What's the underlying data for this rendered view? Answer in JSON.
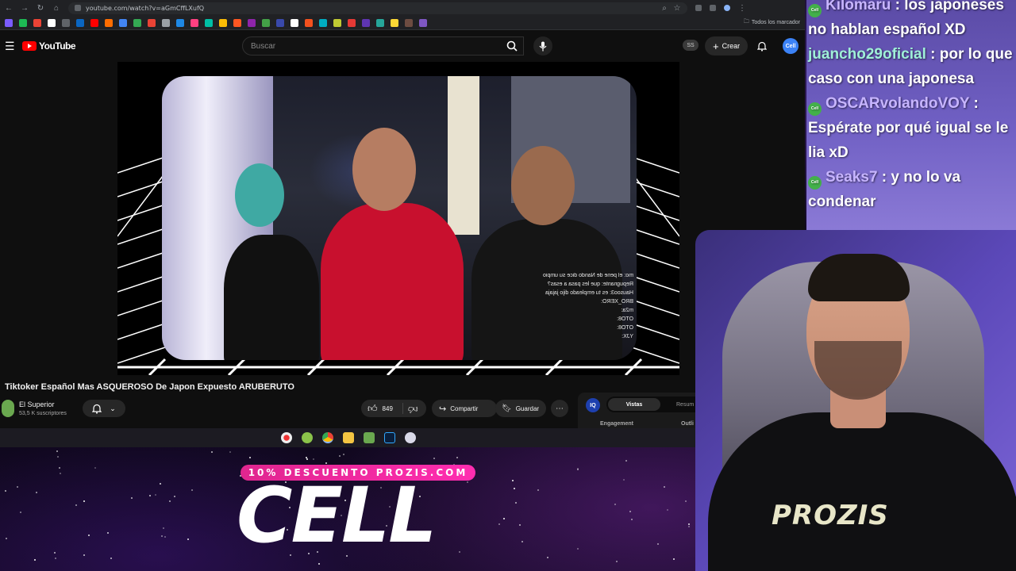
{
  "browser": {
    "url": "youtube.com/watch?v=aGmCffLXufQ",
    "bookmarks_folder": "Todos los marcador"
  },
  "youtube": {
    "brand": "YouTube",
    "search_placeholder": "Buscar",
    "ss_badge": "SS",
    "create_label": "Crear",
    "avatar_label": "Cell"
  },
  "video": {
    "title": "Tiktoker Español Mas ASQUEROSO De Japon Expuesto ARUBERUTO",
    "channel_name": "El Superior",
    "channel_subs": "53,5 K suscriptores",
    "likes": "849",
    "share_label": "Compartir",
    "save_label": "Guardar",
    "embedded_chat": [
      "mo: el pene de Nando dice su umpio",
      "Repugnante: que les pasa a esas?",
      "Hausoo3: es tu empleado dijo jajaja",
      "BRO_XERO:",
      "m2a:",
      "OTO8:",
      "OTO8:",
      "YJX:"
    ]
  },
  "extension": {
    "icon_label": "IQ",
    "tab_active": "Vistas",
    "tab_other": "Resum",
    "section_left": "Engagement",
    "section_right": "Outli"
  },
  "stream_chat": [
    {
      "user": "Kilomaru",
      "text": " : los japoneses no hablan español XD",
      "badge": "Cell"
    },
    {
      "user": "juancho29oficial",
      "text": " : por lo que caso con una japonesa",
      "badge": ""
    },
    {
      "user": "OSCARvolandoVOY",
      "text": " : Espérate por qué igual se le lia xD",
      "badge": "Cell"
    },
    {
      "user": "Seaks7",
      "text": " : y no lo va condenar",
      "badge": "Cell"
    }
  ],
  "webcam": {
    "shirt_text": "PROZIS"
  },
  "promo": {
    "banner": "10% DESCUENTO PROZIS.COM",
    "word": "CELL"
  },
  "colors": {
    "youtube_red": "#ff0000",
    "promo_pink": "#ff2db0",
    "chat_user": "#c7b5ff",
    "badge_green": "#43b04a"
  }
}
